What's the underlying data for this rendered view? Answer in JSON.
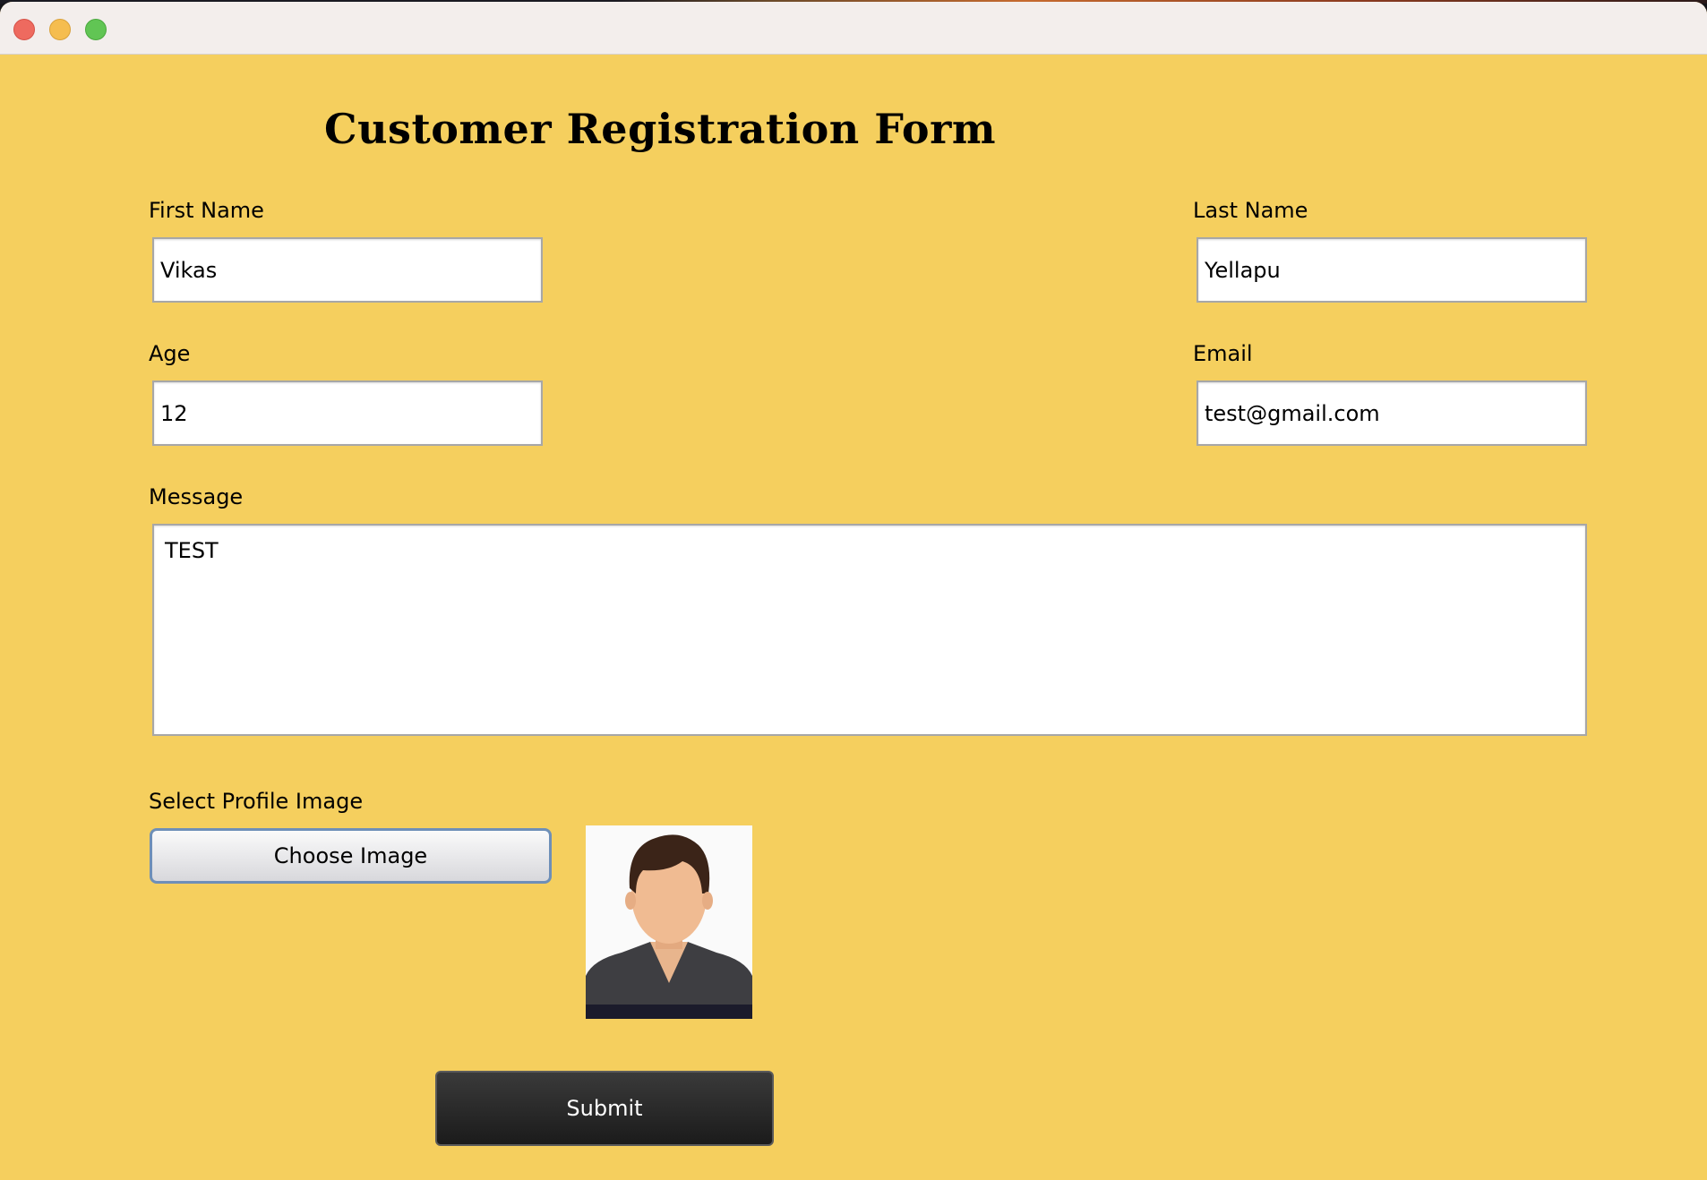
{
  "window": {
    "controls": {
      "close_icon": "close-traffic-light",
      "minimize_icon": "minimize-traffic-light",
      "zoom_icon": "zoom-traffic-light"
    }
  },
  "form": {
    "title": "Customer Registration Form",
    "first_name": {
      "label": "First Name",
      "value": "Vikas"
    },
    "last_name": {
      "label": "Last Name",
      "value": "Yellapu"
    },
    "age": {
      "label": "Age",
      "value": "12"
    },
    "email": {
      "label": "Email",
      "value": "test@gmail.com"
    },
    "message": {
      "label": "Message",
      "value": "TEST"
    },
    "profile_image": {
      "label": "Select Profile Image",
      "button_label": "Choose Image",
      "preview_icon": "avatar-person-icon"
    },
    "submit_label": "Submit"
  },
  "colors": {
    "background": "#f5cf5e",
    "titlebar": "#f3eeec",
    "submit_button": "#1f1f1f",
    "close": "#ee6a5f",
    "minimize": "#f5bd4f",
    "zoom": "#61c554"
  }
}
